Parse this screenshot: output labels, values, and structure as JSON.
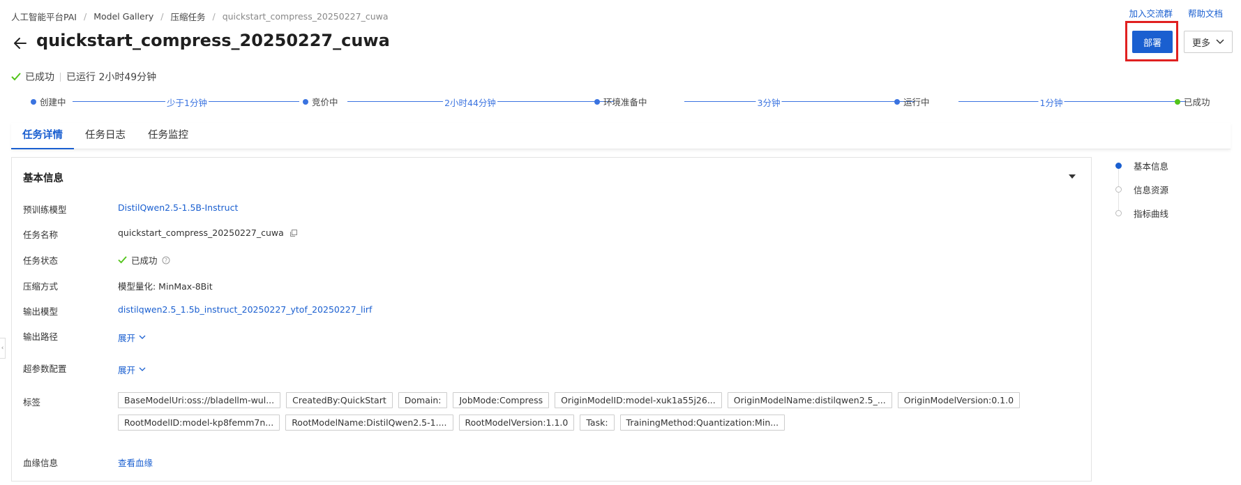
{
  "breadcrumb": {
    "items": [
      "人工智能平台PAI",
      "Model Gallery",
      "压缩任务",
      "quickstart_compress_20250227_cuwa"
    ]
  },
  "toplinks": {
    "join": "加入交流群",
    "help": "帮助文档"
  },
  "header": {
    "title": "quickstart_compress_20250227_cuwa",
    "deploy_label": "部署",
    "more_label": "更多"
  },
  "status": {
    "state": "已成功",
    "runtime": "已运行 2小时49分钟",
    "color": "#52c41a"
  },
  "timeline": {
    "stages": [
      "创建中",
      "竞价中",
      "环境准备中",
      "运行中",
      "已成功"
    ],
    "durations": [
      "少于1分钟",
      "2小时44分钟",
      "3分钟",
      "1分钟"
    ]
  },
  "tabs": [
    "任务详情",
    "任务日志",
    "任务监控"
  ],
  "panel": {
    "title": "基本信息",
    "rows": [
      {
        "label": "预训练模型",
        "value": "DistilQwen2.5-1.5B-Instruct"
      },
      {
        "label": "任务名称",
        "value": "quickstart_compress_20250227_cuwa"
      },
      {
        "label": "任务状态",
        "value": "已成功"
      },
      {
        "label": "压缩方式",
        "value": "模型量化: MinMax-8Bit"
      },
      {
        "label": "输出模型",
        "value": "distilqwen2.5_1.5b_instruct_20250227_ytof_20250227_lirf"
      },
      {
        "label": "输出路径",
        "value": "展开"
      },
      {
        "label": "超参数配置",
        "value": "展开"
      },
      {
        "label": "标签",
        "value": ""
      },
      {
        "label": "血缘信息",
        "value": "查看血缘"
      }
    ],
    "tags": [
      "BaseModelUri:oss://bladellm-wul...",
      "CreatedBy:QuickStart",
      "Domain:",
      "JobMode:Compress",
      "OriginModelID:model-xuk1a55j26...",
      "OriginModelName:distilqwen2.5_...",
      "OriginModelVersion:0.1.0",
      "RootModelID:model-kp8femm7n...",
      "RootModelName:DistilQwen2.5-1....",
      "RootModelVersion:1.1.0",
      "Task:",
      "TrainingMethod:Quantization:Min..."
    ]
  },
  "anchor_nav": [
    "基本信息",
    "信息资源",
    "指标曲线"
  ],
  "colors": {
    "accent": "#1a5fd0",
    "highlight": "#e02020",
    "success": "#52c41a"
  }
}
